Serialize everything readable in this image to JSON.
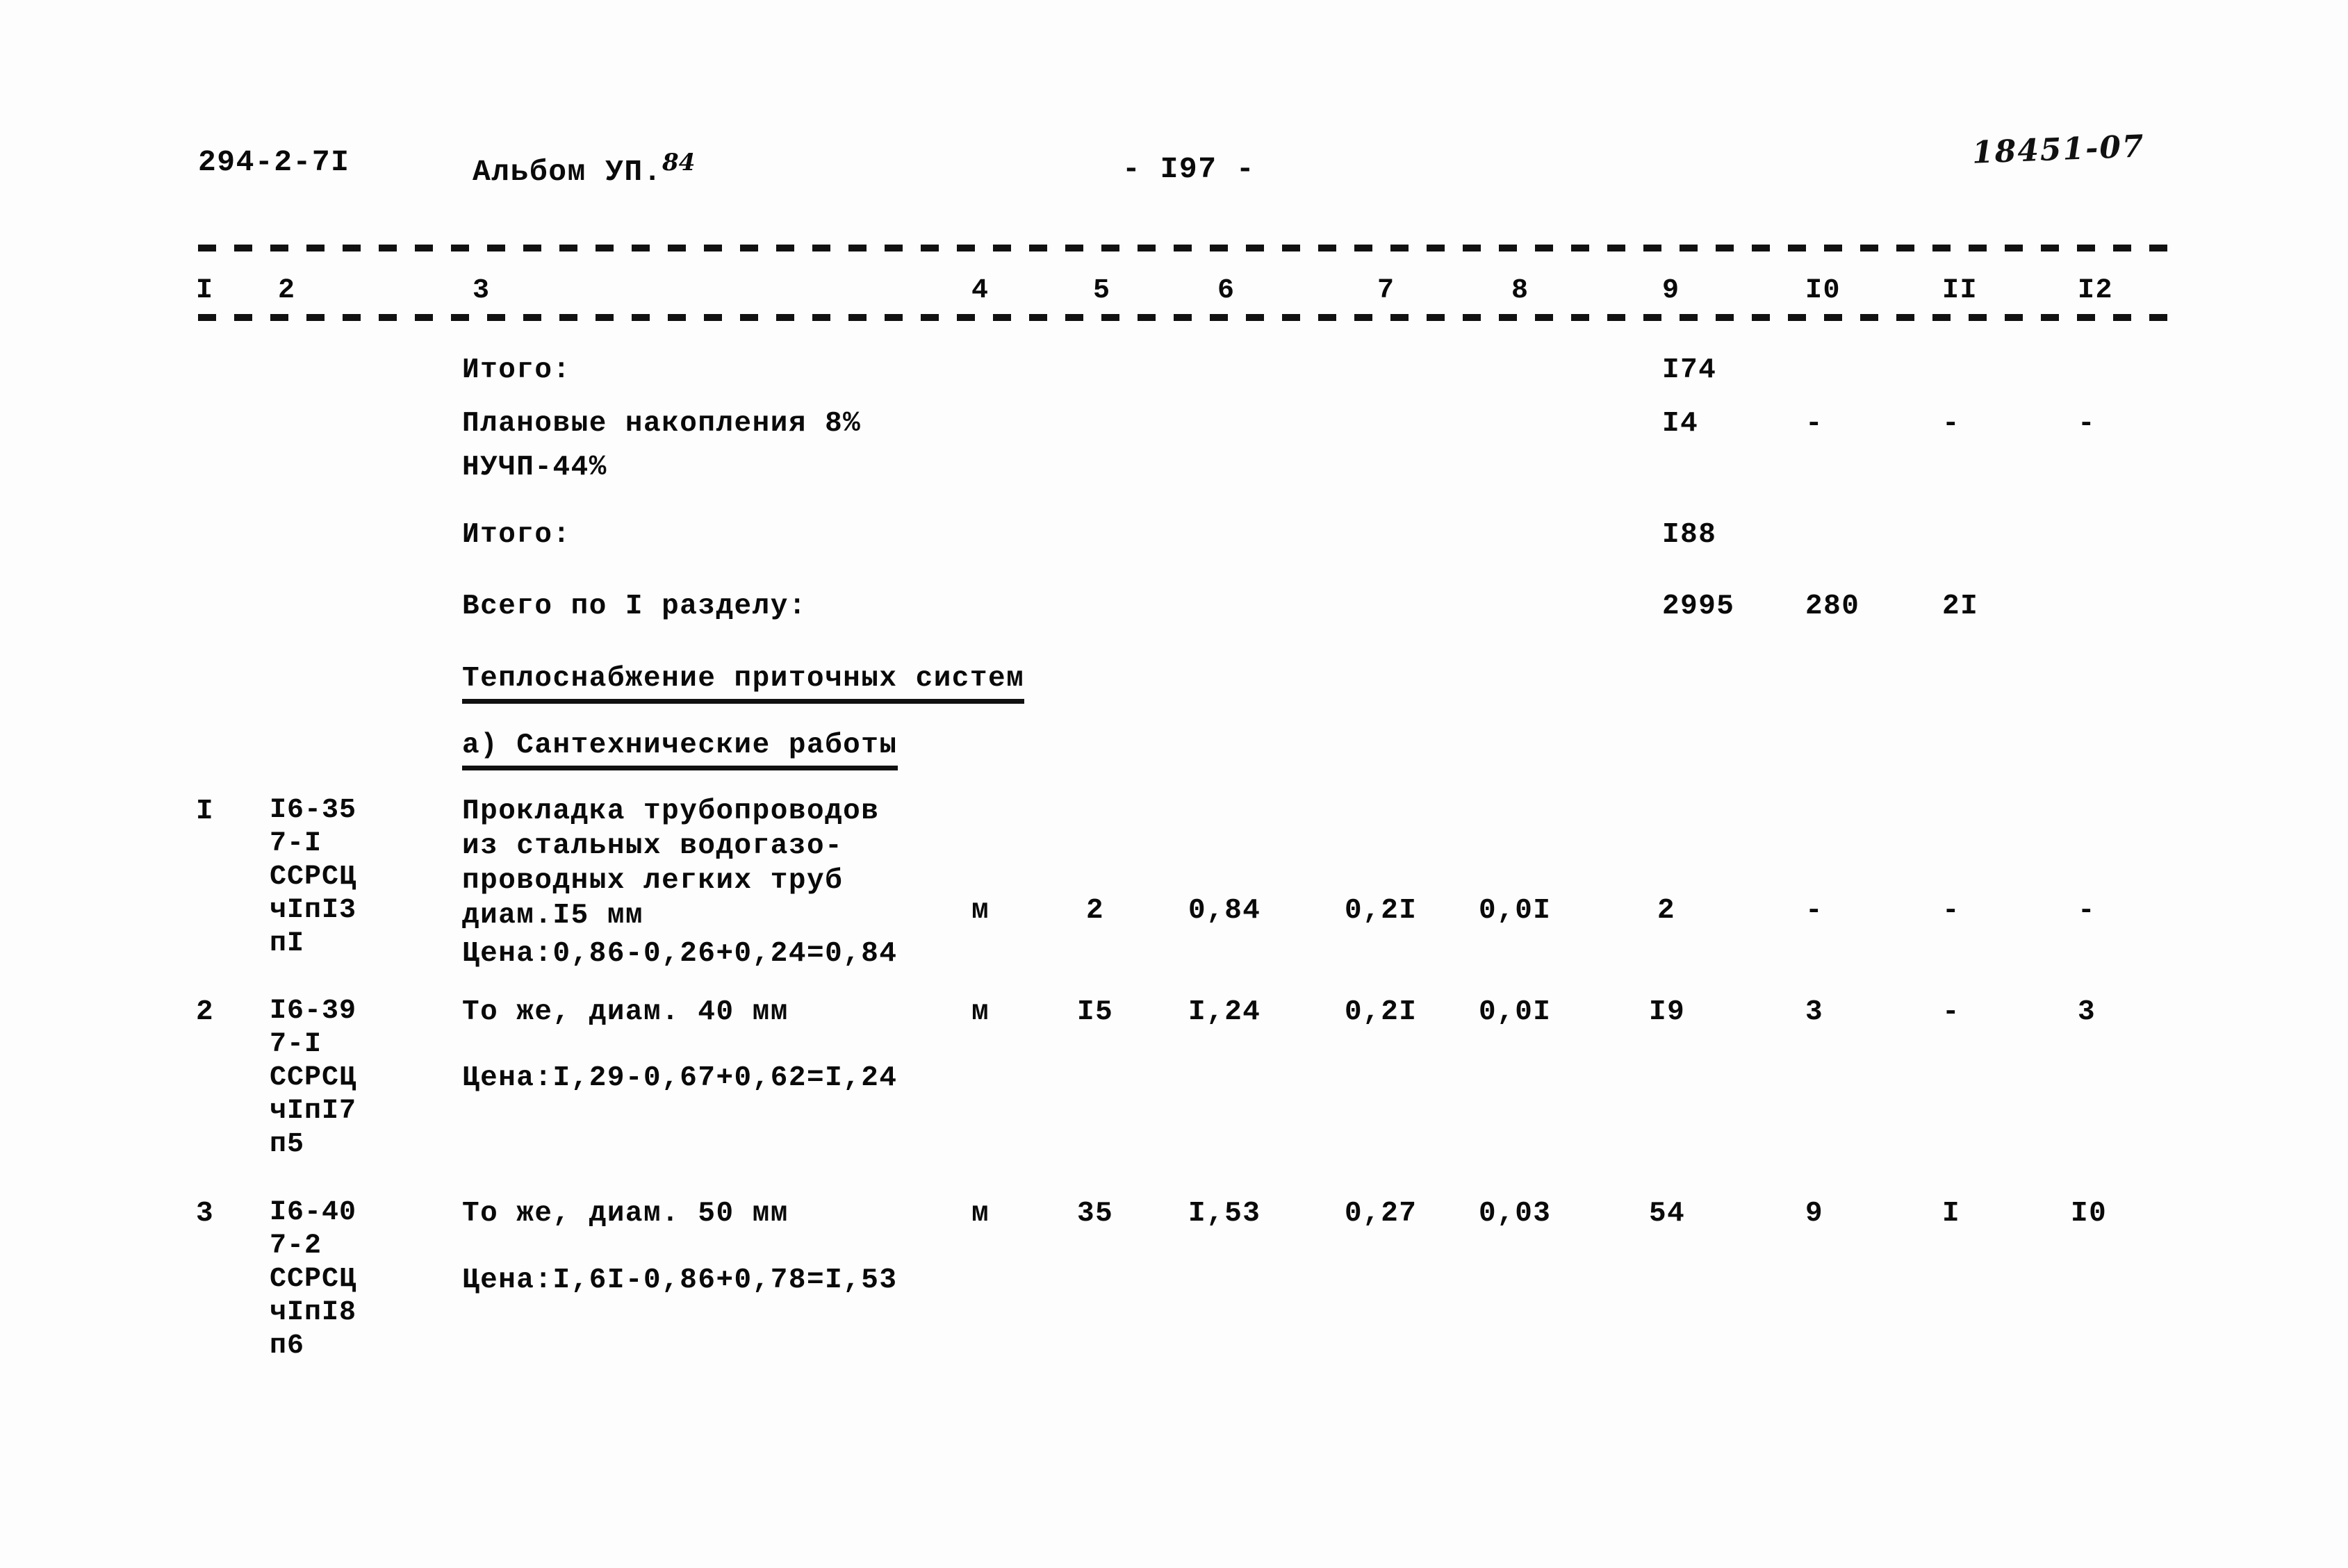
{
  "header": {
    "doc_code": "294-2-7I",
    "album_label": "Альбом УП.",
    "album_number": "84",
    "page_marker": "- I97 -",
    "stamp": "18451-07"
  },
  "table": {
    "column_numbers": [
      "I",
      "2",
      "3",
      "4",
      "5",
      "6",
      "7",
      "8",
      "9",
      "I0",
      "II",
      "I2"
    ],
    "summary_rows": [
      {
        "label": "Итого:",
        "col9": "I74",
        "col10": "",
        "col11": "",
        "col12": ""
      },
      {
        "label": "Плановые накопления 8%",
        "col9": "I4",
        "col10": "-",
        "col11": "-",
        "col12": "-"
      },
      {
        "label": "НУЧП-44%",
        "col9": "",
        "col10": "",
        "col11": "",
        "col12": ""
      },
      {
        "label": "Итого:",
        "col9": "I88",
        "col10": "",
        "col11": "",
        "col12": ""
      },
      {
        "label": "Всего по I разделу:",
        "col9": "2995",
        "col10": "280",
        "col11": "2I",
        "col12": ""
      }
    ],
    "section_title": "Теплоснабжение приточных систем",
    "subsection_title": "а) Сантехнические работы",
    "rows": [
      {
        "no": "I",
        "code": "I6-35\n7-I\nССРСЦ\nчIпI3\nпI",
        "description": "Прокладка трубопроводов\nиз стальных водогазо-\nпроводных легких труб\nдиам.I5 мм",
        "price_note": "Цена:0,86-0,26+0,24=0,84",
        "unit": "м",
        "qty": "2",
        "col6": "0,84",
        "col7": "0,2I",
        "col8": "0,0I",
        "col9": "2",
        "col10": "-",
        "col11": "-",
        "col12": "-"
      },
      {
        "no": "2",
        "code": "I6-39\n7-I\nССРСЦ\nчIпI7\nп5",
        "description": "То же, диам. 40 мм",
        "price_note": "Цена:I,29-0,67+0,62=I,24",
        "unit": "м",
        "qty": "I5",
        "col6": "I,24",
        "col7": "0,2I",
        "col8": "0,0I",
        "col9": "I9",
        "col10": "3",
        "col11": "-",
        "col12": "3"
      },
      {
        "no": "3",
        "code": "I6-40\n7-2\nССРСЦ\nчIпI8\nп6",
        "description": "То же, диам. 50 мм",
        "price_note": "Цена:I,6I-0,86+0,78=I,53",
        "unit": "м",
        "qty": "35",
        "col6": "I,53",
        "col7": "0,27",
        "col8": "0,03",
        "col9": "54",
        "col10": "9",
        "col11": "I",
        "col12": "I0"
      }
    ]
  },
  "colors": {
    "ink": "#0a0a0a",
    "paper": "#fdfdfd"
  }
}
